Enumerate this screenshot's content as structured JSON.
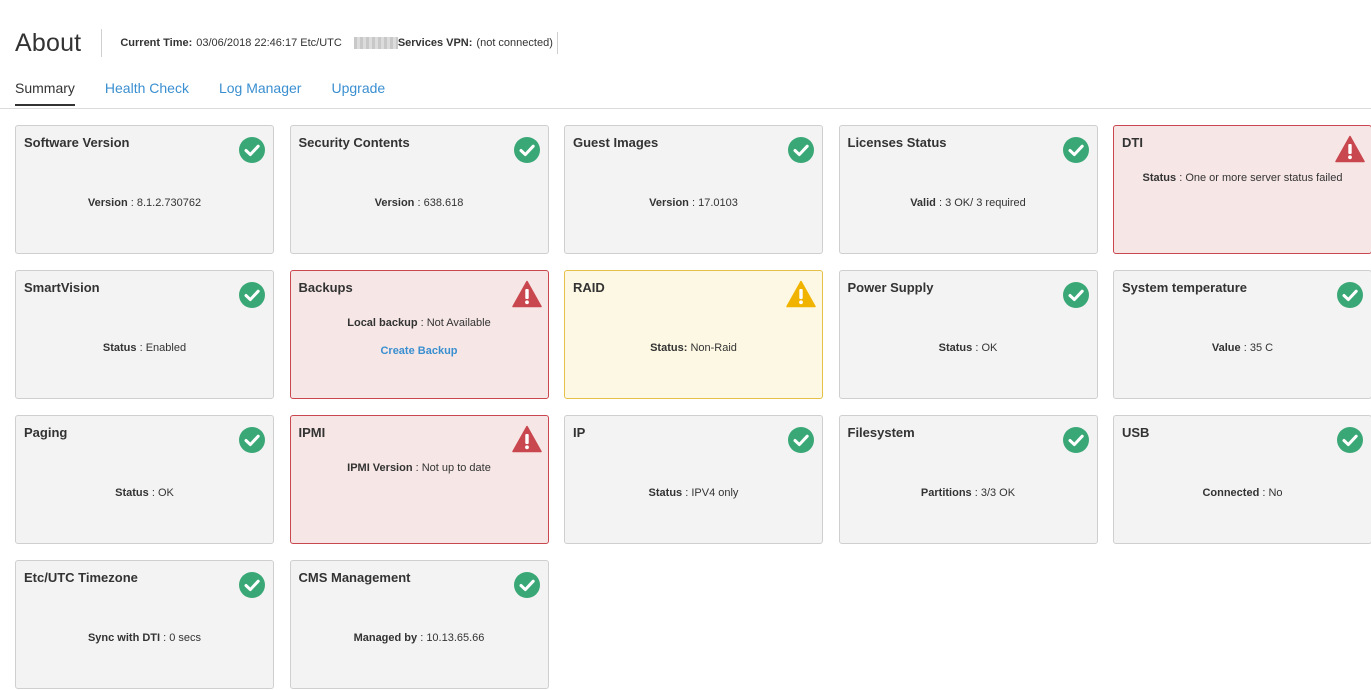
{
  "header": {
    "title": "About",
    "current_time_label": "Current Time:",
    "current_time_value": "03/06/2018 22:46:17 Etc/UTC",
    "vpn_label": "Services VPN:",
    "vpn_value": "(not connected)"
  },
  "tabs": [
    {
      "label": "Summary",
      "active": true
    },
    {
      "label": "Health Check",
      "active": false
    },
    {
      "label": "Log Manager",
      "active": false
    },
    {
      "label": "Upgrade",
      "active": false
    }
  ],
  "colors": {
    "ok": "#3aa876",
    "error": "#c9474e",
    "warn": "#f0b400",
    "link": "#3a8fd0"
  },
  "cards": [
    {
      "title": "Software Version",
      "status": "ok",
      "icon": "check-circle-icon",
      "label": "Version",
      "sep": " : ",
      "value": "8.1.2.730762"
    },
    {
      "title": "Security Contents",
      "status": "ok",
      "icon": "check-circle-icon",
      "label": "Version",
      "sep": " : ",
      "value": "638.618"
    },
    {
      "title": "Guest Images",
      "status": "ok",
      "icon": "check-circle-icon",
      "label": "Version",
      "sep": " : ",
      "value": "17.0103"
    },
    {
      "title": "Licenses Status",
      "status": "ok",
      "icon": "check-circle-icon",
      "label": "Valid",
      "sep": " : ",
      "value": "3 OK/ 3 required"
    },
    {
      "title": "DTI",
      "status": "error",
      "icon": "warning-triangle-icon",
      "label": "Status",
      "sep": " : ",
      "value": "One or more server status failed"
    },
    {
      "title": "SmartVision",
      "status": "ok",
      "icon": "check-circle-icon",
      "label": "Status",
      "sep": " : ",
      "value": "Enabled"
    },
    {
      "title": "Backups",
      "status": "error",
      "icon": "warning-triangle-icon",
      "label": "Local backup",
      "sep": " : ",
      "value": "Not Available",
      "link": "Create Backup"
    },
    {
      "title": "RAID",
      "status": "warn",
      "icon": "warning-triangle-icon",
      "label": "Status:",
      "sep": " ",
      "value": "Non-Raid"
    },
    {
      "title": "Power Supply",
      "status": "ok",
      "icon": "check-circle-icon",
      "label": "Status",
      "sep": " : ",
      "value": "OK"
    },
    {
      "title": "System temperature",
      "status": "ok",
      "icon": "check-circle-icon",
      "label": "Value",
      "sep": " : ",
      "value": "35 C"
    },
    {
      "title": "Paging",
      "status": "ok",
      "icon": "check-circle-icon",
      "label": "Status",
      "sep": " : ",
      "value": "OK"
    },
    {
      "title": "IPMI",
      "status": "error",
      "icon": "warning-triangle-icon",
      "label": "IPMI Version",
      "sep": " : ",
      "value": "Not up to date"
    },
    {
      "title": "IP",
      "status": "ok",
      "icon": "check-circle-icon",
      "label": "Status",
      "sep": " : ",
      "value": "IPV4 only"
    },
    {
      "title": "Filesystem",
      "status": "ok",
      "icon": "check-circle-icon",
      "label": "Partitions",
      "sep": " : ",
      "value": "3/3 OK"
    },
    {
      "title": "USB",
      "status": "ok",
      "icon": "check-circle-icon",
      "label": "Connected",
      "sep": " : ",
      "value": "No"
    },
    {
      "title": "Etc/UTC Timezone",
      "status": "ok",
      "icon": "check-circle-icon",
      "label": "Sync with DTI",
      "sep": " : ",
      "value": "0 secs"
    },
    {
      "title": "CMS Management",
      "status": "ok",
      "icon": "check-circle-icon",
      "label": "Managed by",
      "sep": " : ",
      "value": "10.13.65.66"
    }
  ]
}
